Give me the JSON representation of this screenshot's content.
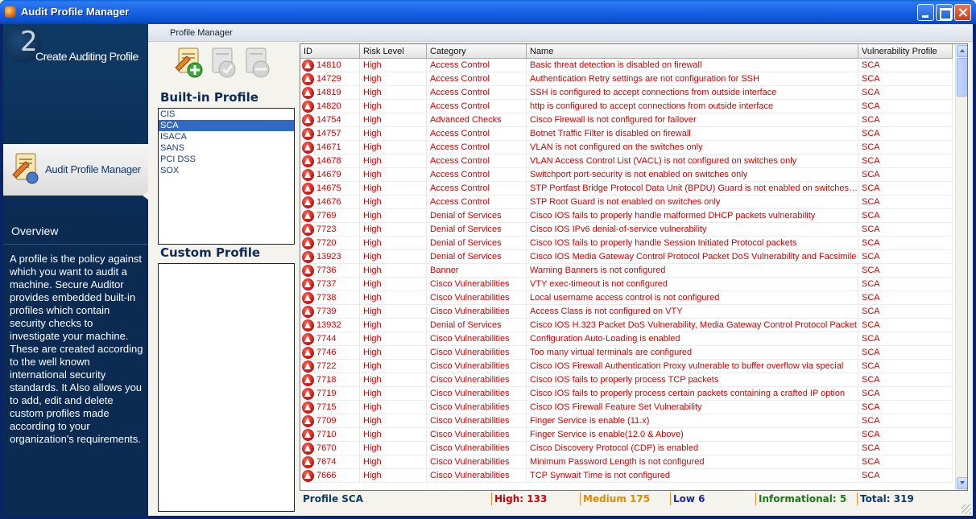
{
  "window": {
    "title": "Audit Profile Manager"
  },
  "nav": {
    "create_number": "2",
    "create_label": "Create Auditing Profile",
    "active_label": "Audit Profile Manager",
    "overview_title": "Overview",
    "overview_text": "A profile is the policy against which you want to audit a machine. Secure Auditor provides embedded built-in profiles which contain security checks to investigate your machine. These are created according to the well known international security standards. It Also allows you to add, edit and delete custom profiles made according to your organization's requirements."
  },
  "tab": {
    "label": "Profile Manager"
  },
  "toolbar": {
    "icons": [
      "add-profile-icon",
      "edit-profile-icon",
      "delete-profile-icon"
    ]
  },
  "builtin": {
    "title": "Built-in Profile",
    "items": [
      "CIS",
      "SCA",
      "ISACA",
      "SANS",
      "PCI DSS",
      "SOX"
    ],
    "selected": "SCA"
  },
  "custom": {
    "title": "Custom Profile",
    "items": []
  },
  "grid": {
    "columns": [
      "ID",
      "Risk Level",
      "Category",
      "Name",
      "Vulnerability Profile"
    ],
    "rows": [
      [
        "14810",
        "High",
        "Access Control",
        "Basic threat detection is disabled on firewall",
        "SCA"
      ],
      [
        "14729",
        "High",
        "Access Control",
        "Authentication Retry settings are not configuration for SSH",
        "SCA"
      ],
      [
        "14819",
        "High",
        "Access Control",
        "SSH is configured to accept connections from outside interface",
        "SCA"
      ],
      [
        "14820",
        "High",
        "Access Control",
        "http is configured to accept connections from outside interface",
        "SCA"
      ],
      [
        "14754",
        "High",
        "Advanced Checks",
        "Cisco Firewall is not configured for failover",
        "SCA"
      ],
      [
        "14757",
        "High",
        "Access Control",
        "Botnet Traffic Filter is disabled on firewall",
        "SCA"
      ],
      [
        "14671",
        "High",
        "Access Control",
        "VLAN is not configured on the switches only",
        "SCA"
      ],
      [
        "14678",
        "High",
        "Access Control",
        "VLAN Access Control List (VACL) is not configured on switches only",
        "SCA"
      ],
      [
        "14679",
        "High",
        "Access Control",
        "Switchport port-security is not enabled on switches only",
        "SCA"
      ],
      [
        "14675",
        "High",
        "Access Control",
        "STP Portfast Bridge Protocol Data Unit (BPDU) Guard is not enabled on switches only",
        "SCA"
      ],
      [
        "14676",
        "High",
        "Access Control",
        "STP Root Guard is not enabled on switches only",
        "SCA"
      ],
      [
        "7769",
        "High",
        "Denial of Services",
        "Cisco IOS fails to properly handle malformed DHCP packets vulnerability",
        "SCA"
      ],
      [
        "7723",
        "High",
        "Denial of Services",
        "Cisco IOS IPv6 denial-of-service vulnerability",
        "SCA"
      ],
      [
        "7720",
        "High",
        "Denial of Services",
        "Cisco IOS fails to properly handle Session Initiated Protocol packets",
        "SCA"
      ],
      [
        "13923",
        "High",
        "Denial of Services",
        "Cisco IOS Media Gateway Control Protocol Packet DoS Vulnerability and Facsimile",
        "SCA"
      ],
      [
        "7736",
        "High",
        "Banner",
        "Warning Banners is not configured",
        "SCA"
      ],
      [
        "7737",
        "High",
        "Cisco Vulnerabilities",
        "VTY exec-timeout is not configured",
        "SCA"
      ],
      [
        "7738",
        "High",
        "Cisco Vulnerabilities",
        "Local username access control is not configured",
        "SCA"
      ],
      [
        "7739",
        "High",
        "Cisco Vulnerabilities",
        "Access Class is not configured on VTY",
        "SCA"
      ],
      [
        "13932",
        "High",
        "Denial of Services",
        "Cisco IOS H.323 Packet DoS Vulnerability, Media Gateway Control Protocol Packet",
        "SCA"
      ],
      [
        "7744",
        "High",
        "Cisco Vulnerabilities",
        "Configuration Auto-Loading is enabled",
        "SCA"
      ],
      [
        "7746",
        "High",
        "Cisco Vulnerabilities",
        "Too many virtual terminals are configured",
        "SCA"
      ],
      [
        "7722",
        "High",
        "Cisco Vulnerabilities",
        "Cisco IOS Firewall Authentication Proxy vulnerable to buffer overflow via special",
        "SCA"
      ],
      [
        "7718",
        "High",
        "Cisco Vulnerabilities",
        "Cisco IOS fails to properly process TCP packets",
        "SCA"
      ],
      [
        "7719",
        "High",
        "Cisco Vulnerabilities",
        "Cisco IOS fails to properly process certain packets containing a crafted IP option",
        "SCA"
      ],
      [
        "7715",
        "High",
        "Cisco Vulnerabilities",
        "Cisco IOS Firewall Feature Set Vulnerability",
        "SCA"
      ],
      [
        "7709",
        "High",
        "Cisco Vulnerabilities",
        "Finger Service is enable (11.x)",
        "SCA"
      ],
      [
        "7710",
        "High",
        "Cisco Vulnerabilities",
        "Finger Service is enable(12.0 & Above)",
        "SCA"
      ],
      [
        "7670",
        "High",
        "Cisco Vulnerabilities",
        "Cisco Discovery Protocol (CDP) is enabled",
        "SCA"
      ],
      [
        "7674",
        "High",
        "Cisco Vulnerabilities",
        "Minimum Password Length is not configured",
        "SCA"
      ],
      [
        "7666",
        "High",
        "Cisco Vulnerabilities",
        "TCP Synwait Time is not configured",
        "SCA"
      ]
    ]
  },
  "status": {
    "profile": "Profile SCA",
    "high": "High: 133",
    "medium": "Medium 175",
    "low": "Low 6",
    "info": "Informational: 5",
    "total": "Total: 319",
    "colors": {
      "profile": "#0b3a66",
      "high": "#d40000",
      "medium": "#e08a00",
      "low": "#1a2a9a",
      "info": "#1a7a1a",
      "total": "#0b3a66"
    }
  }
}
